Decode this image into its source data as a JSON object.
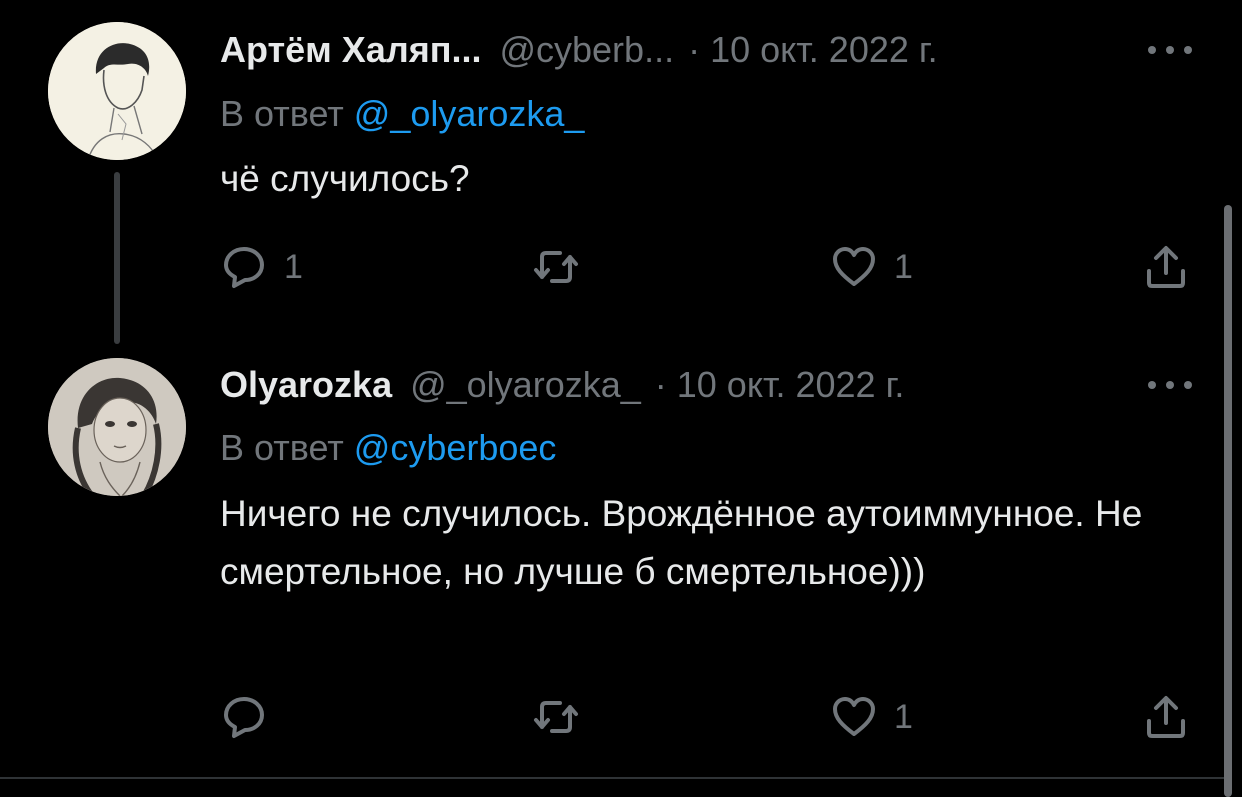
{
  "tweets": [
    {
      "author_name": "Артём Халяп...",
      "handle": "@cyberb...",
      "separator": "·",
      "date": "10 окт. 2022 г.",
      "reply_prefix": "В ответ",
      "reply_mention": "@_olyarozka_",
      "text": "чё случилось?",
      "reply_count": "1",
      "retweet_count": "",
      "like_count": "1"
    },
    {
      "author_name": "Olyarozka",
      "handle": "@_olyarozka_",
      "separator": "·",
      "date": "10 окт. 2022 г.",
      "reply_prefix": "В ответ",
      "reply_mention": "@cyberboec",
      "text": "Ничего не случилось. Врождённое аутоиммунное. Не смертельное, но лучше б смертельное)))",
      "reply_count": "",
      "retweet_count": "",
      "like_count": "1"
    }
  ],
  "icons": {
    "reply": "reply-icon",
    "retweet": "retweet-icon",
    "like": "heart-icon",
    "share": "share-icon",
    "more": "more-icon"
  },
  "colors": {
    "background": "#000000",
    "text": "#e7e9ea",
    "secondary": "#71767b",
    "link": "#1d9bf0"
  }
}
